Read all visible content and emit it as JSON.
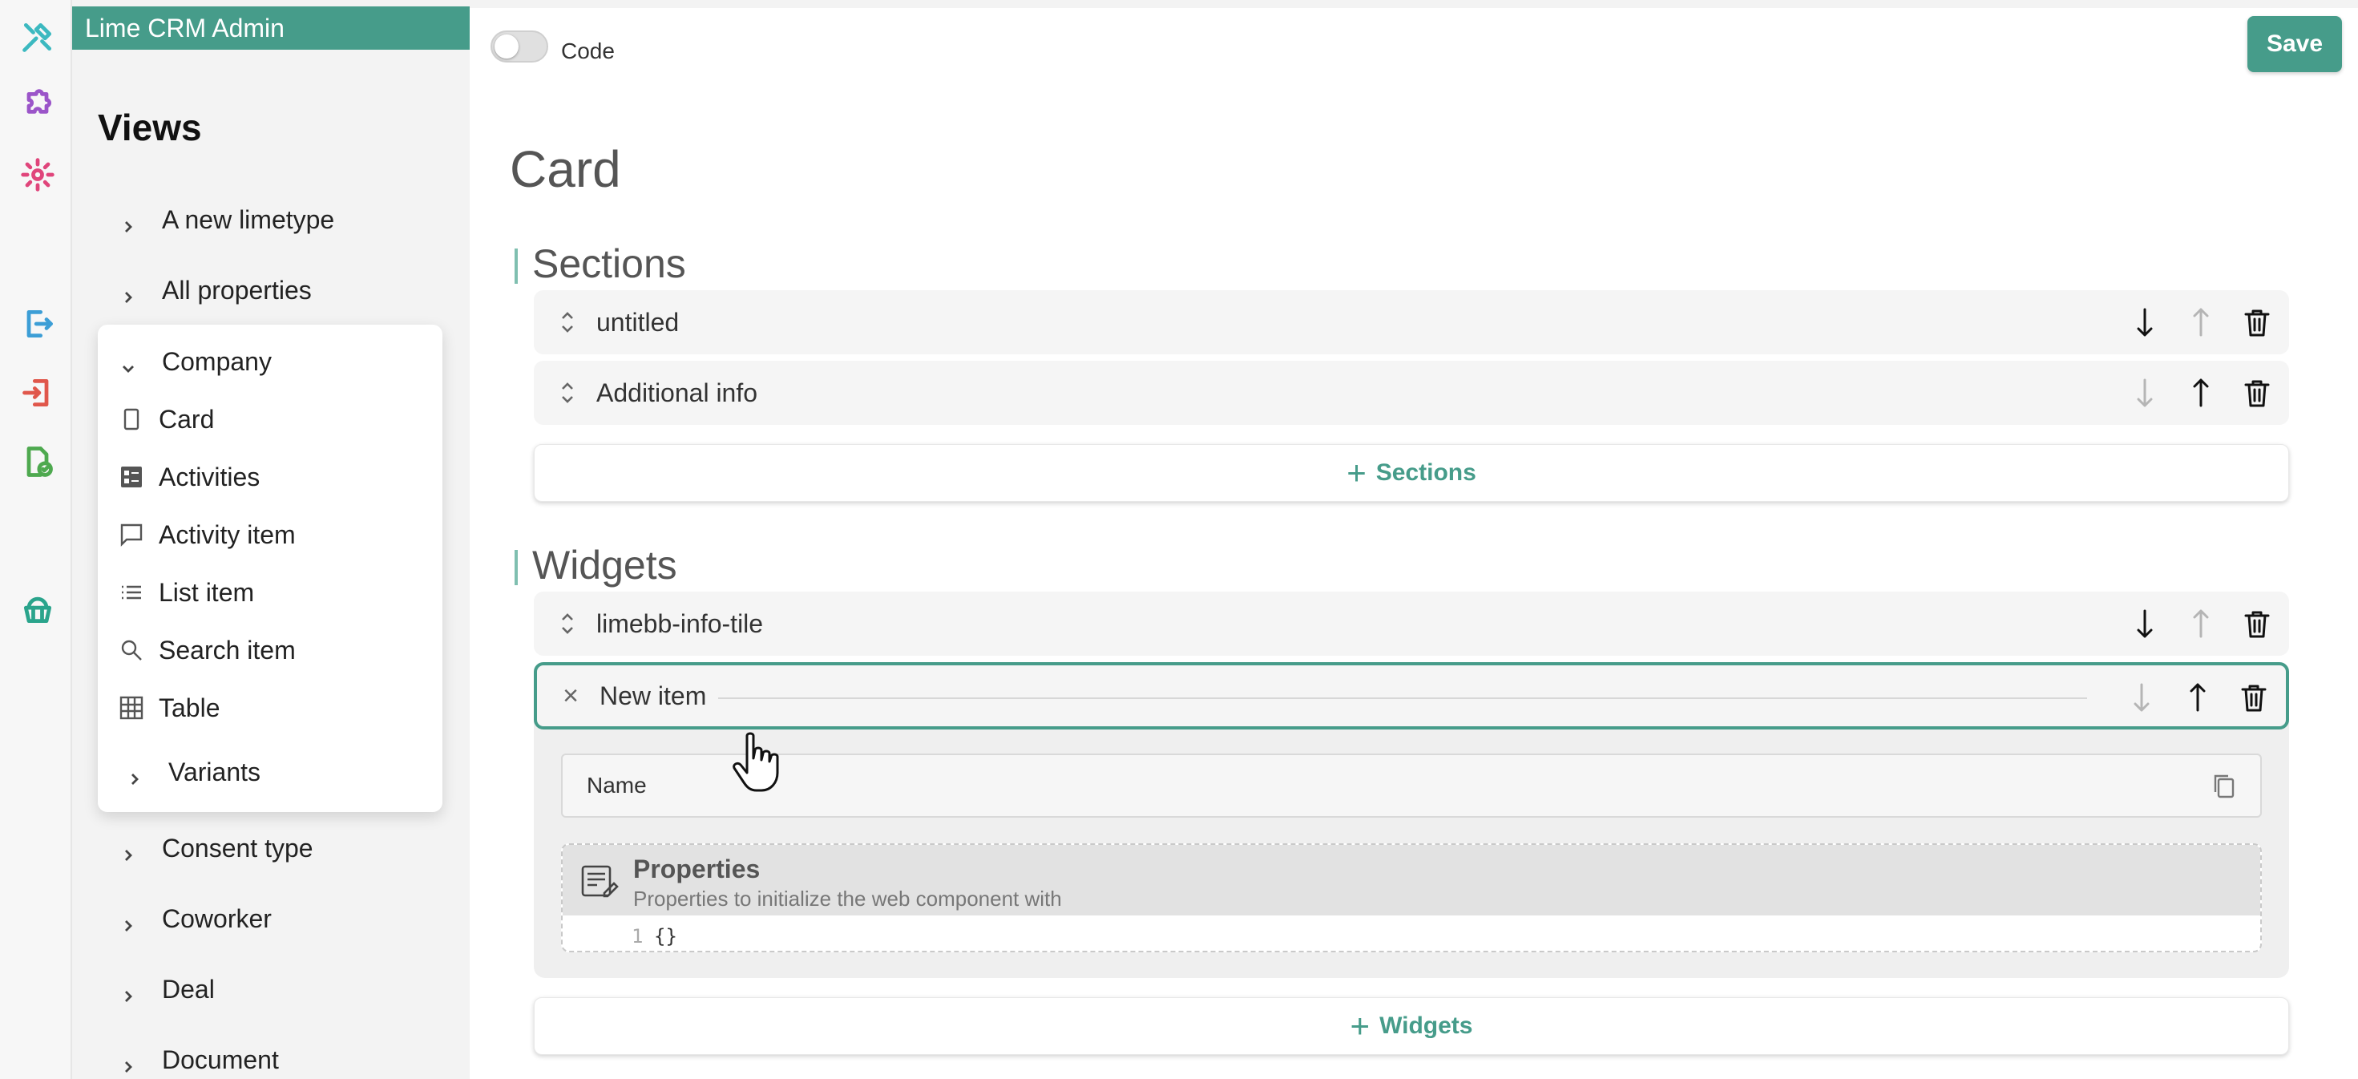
{
  "app": {
    "title": "Lime CRM Admin"
  },
  "rail": {
    "icons": [
      "tools-icon",
      "puzzle-icon",
      "settings-icon",
      "export-icon",
      "import-icon",
      "file-check-icon",
      "cupcake-icon"
    ]
  },
  "nav": {
    "heading": "Views",
    "items_before": [
      "A new limetype",
      "All properties"
    ],
    "company": {
      "label": "Company",
      "children": [
        {
          "label": "Card",
          "icon": "card-icon"
        },
        {
          "label": "Activities",
          "icon": "activities-icon"
        },
        {
          "label": "Activity item",
          "icon": "chat-icon"
        },
        {
          "label": "List item",
          "icon": "list-icon"
        },
        {
          "label": "Search item",
          "icon": "search-icon"
        },
        {
          "label": "Table",
          "icon": "table-icon"
        }
      ],
      "variants": "Variants"
    },
    "items_after": [
      "Consent type",
      "Coworker",
      "Deal",
      "Document"
    ]
  },
  "toolbar": {
    "code_label": "Code",
    "save_label": "Save"
  },
  "page": {
    "title": "Card",
    "sections": {
      "heading": "Sections",
      "items": [
        "untitled",
        "Additional info"
      ],
      "add_label": "Sections"
    },
    "widgets": {
      "heading": "Widgets",
      "items": [
        "limebb-info-tile",
        "New item"
      ],
      "add_label": "Widgets"
    },
    "editor": {
      "name_label": "Name",
      "properties_title": "Properties",
      "properties_subtitle": "Properties to initialize the web component with",
      "line_number": "1",
      "code": "{}"
    }
  },
  "colors": {
    "accent": "#469c8a",
    "header": "#469c8a"
  }
}
